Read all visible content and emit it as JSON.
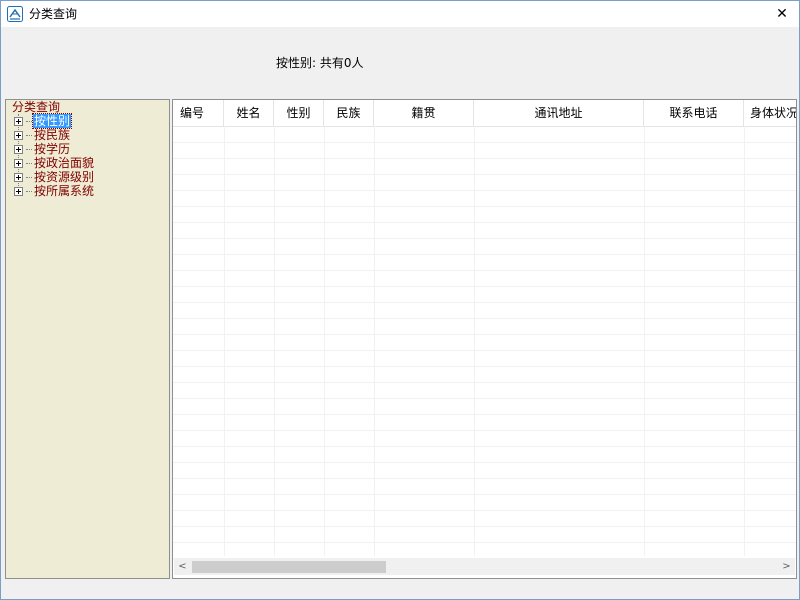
{
  "window": {
    "title": "分类查询",
    "close_glyph": "✕"
  },
  "summary": "按性别: 共有0人",
  "tree": {
    "root": "分类查询",
    "items": [
      {
        "label": "按性别",
        "selected": true
      },
      {
        "label": "按民族"
      },
      {
        "label": "按学历"
      },
      {
        "label": "按政治面貌"
      },
      {
        "label": "按资源级别"
      },
      {
        "label": "按所属系统"
      }
    ]
  },
  "grid": {
    "columns": [
      "编号",
      "姓名",
      "性别",
      "民族",
      "籍贯",
      "通讯地址",
      "联系电话",
      "身体状况"
    ],
    "rows": []
  },
  "scrollbar": {
    "left_arrow": "<",
    "right_arrow": ">"
  },
  "colors": {
    "tree_bg": "#efecd5",
    "tree_text": "#800000",
    "selection": "#3399ff"
  }
}
